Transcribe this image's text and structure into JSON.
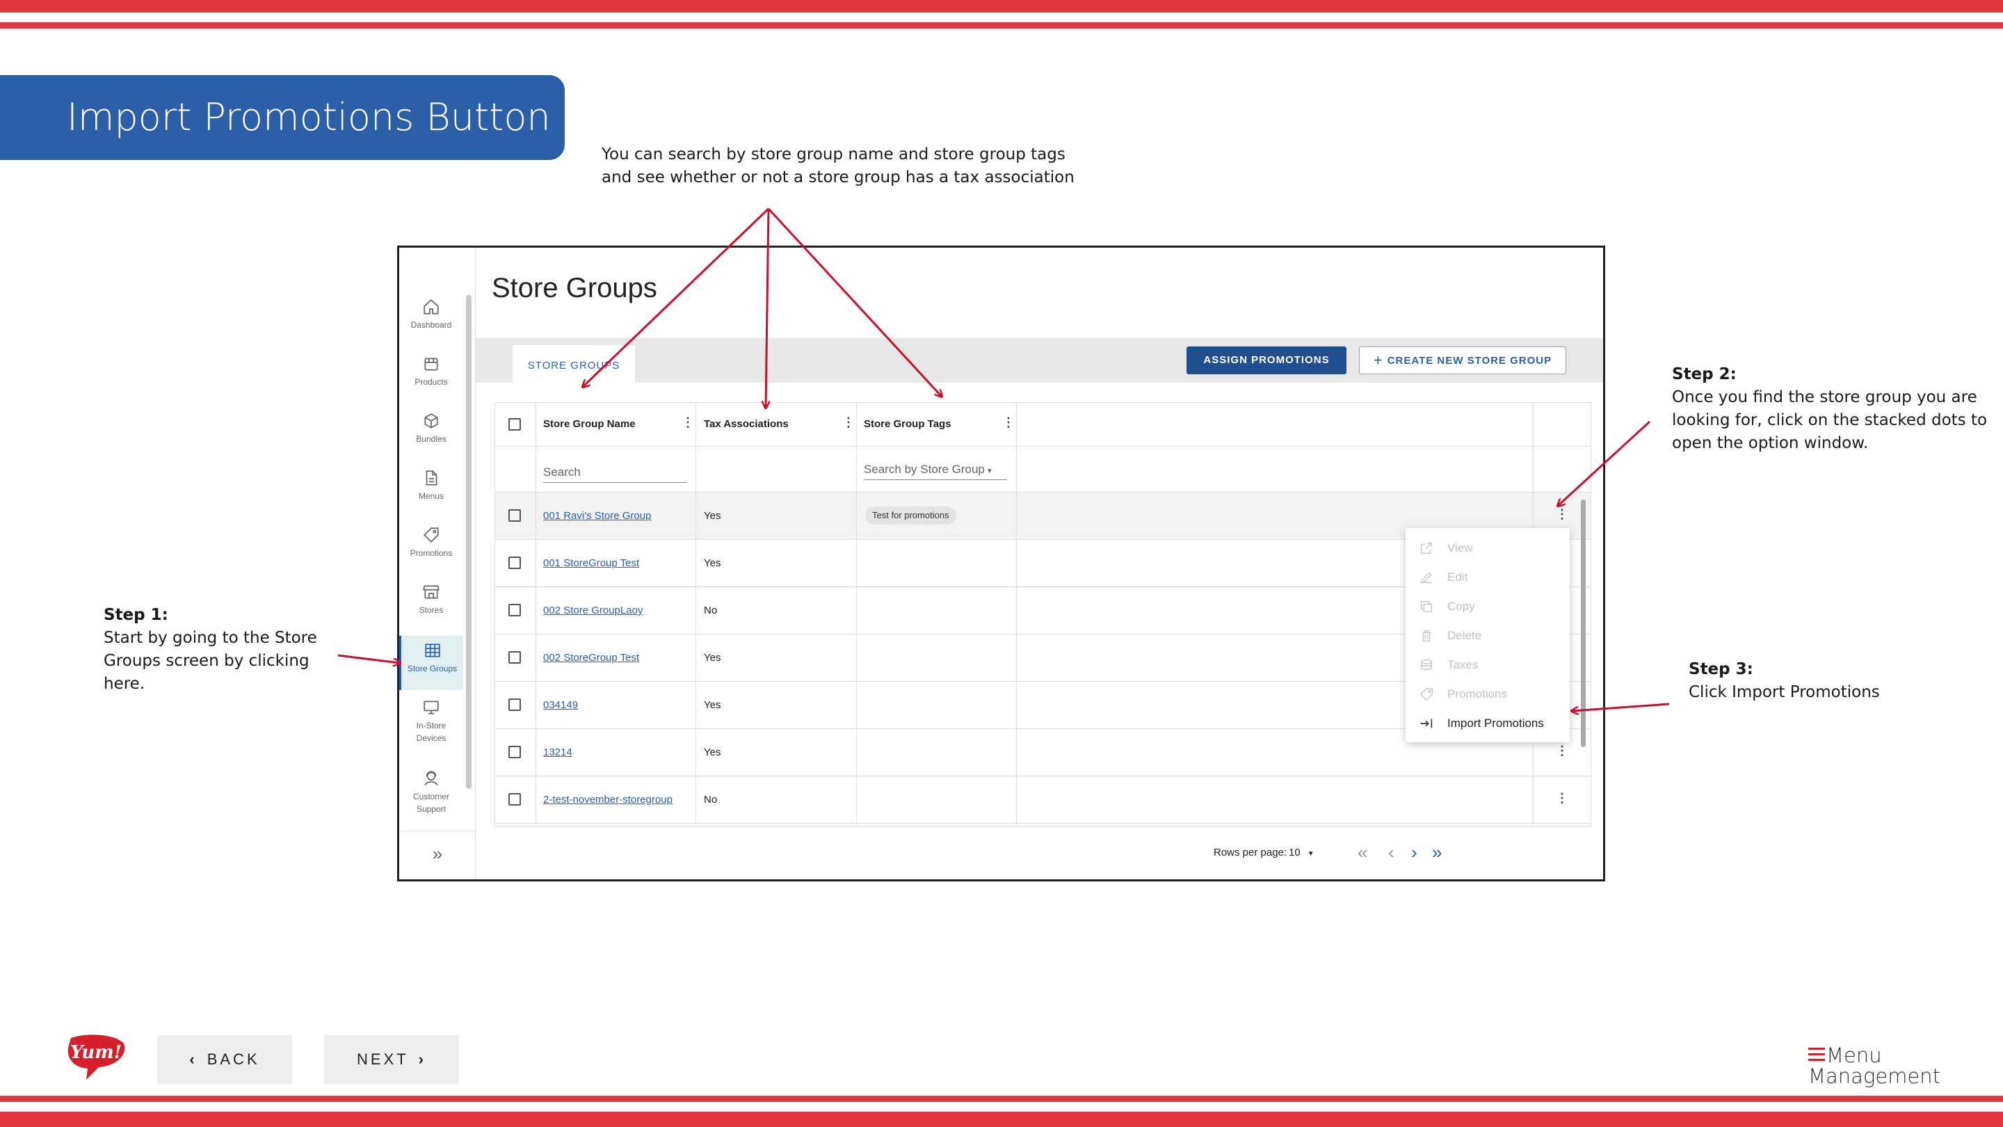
{
  "slide": {
    "title": "Import Promotions Button",
    "annotation_top": [
      "You can search by store group name and store group tags",
      "and see whether or not a store group has a tax association"
    ],
    "step1": {
      "heading": "Step 1:",
      "text": [
        "Start by going to the Store",
        "Groups screen by clicking",
        "here."
      ]
    },
    "step2": {
      "heading": "Step 2:",
      "text": [
        "Once you find the store group you are",
        "looking for, click on the stacked dots to",
        "open the option window."
      ]
    },
    "step3": {
      "heading": "Step 3:",
      "text": [
        "Click Import Promotions"
      ]
    },
    "back_label": "BACK",
    "next_label": "NEXT",
    "yum_logo_text": "Yum!",
    "menu_logo": [
      "Menu",
      "Management"
    ]
  },
  "colors": {
    "stripe": "#e2373f",
    "banner": "#2b5fa8",
    "primary": "#1f4f8f",
    "arrow": "#c8102e"
  },
  "app": {
    "nav": [
      {
        "label": "Dashboard",
        "icon": "home-icon"
      },
      {
        "label": "Products",
        "icon": "box-icon"
      },
      {
        "label": "Bundles",
        "icon": "cube-icon"
      },
      {
        "label": "Menus",
        "icon": "document-icon"
      },
      {
        "label": "Promotions",
        "icon": "tag-icon"
      },
      {
        "label": "Stores",
        "icon": "storefront-icon"
      },
      {
        "label": "Store Groups",
        "icon": "grid-icon",
        "active": true
      },
      {
        "label": "In-Store\nDevices",
        "icon": "monitor-icon"
      },
      {
        "label": "Customer\nSupport",
        "icon": "support-icon"
      }
    ],
    "page_title": "Store Groups",
    "tab_label": "STORE GROUPS",
    "assign_label": "ASSIGN PROMOTIONS",
    "create_label": "CREATE NEW STORE GROUP",
    "columns": [
      "Store Group Name",
      "Tax Associations",
      "Store Group Tags"
    ],
    "search_placeholder": "Search",
    "tags_filter_placeholder": "Search by Store Group",
    "rows": [
      {
        "name": "001 Ravi's Store Group",
        "tax": "Yes",
        "tag": "Test for promotions"
      },
      {
        "name": "001 StoreGroup Test",
        "tax": "Yes",
        "tag": ""
      },
      {
        "name": "002 Store GroupLaoy",
        "tax": "No",
        "tag": ""
      },
      {
        "name": "002 StoreGroup Test",
        "tax": "Yes",
        "tag": ""
      },
      {
        "name": "034149",
        "tax": "Yes",
        "tag": ""
      },
      {
        "name": "13214",
        "tax": "Yes",
        "tag": ""
      },
      {
        "name": "2-test-november-storegroup",
        "tax": "No",
        "tag": ""
      }
    ],
    "menu": [
      "View",
      "Edit",
      "Copy",
      "Delete",
      "Taxes",
      "Promotions",
      "Import Promotions"
    ],
    "rows_per_page_label": "Rows per page:",
    "rows_per_page_value": "10"
  }
}
